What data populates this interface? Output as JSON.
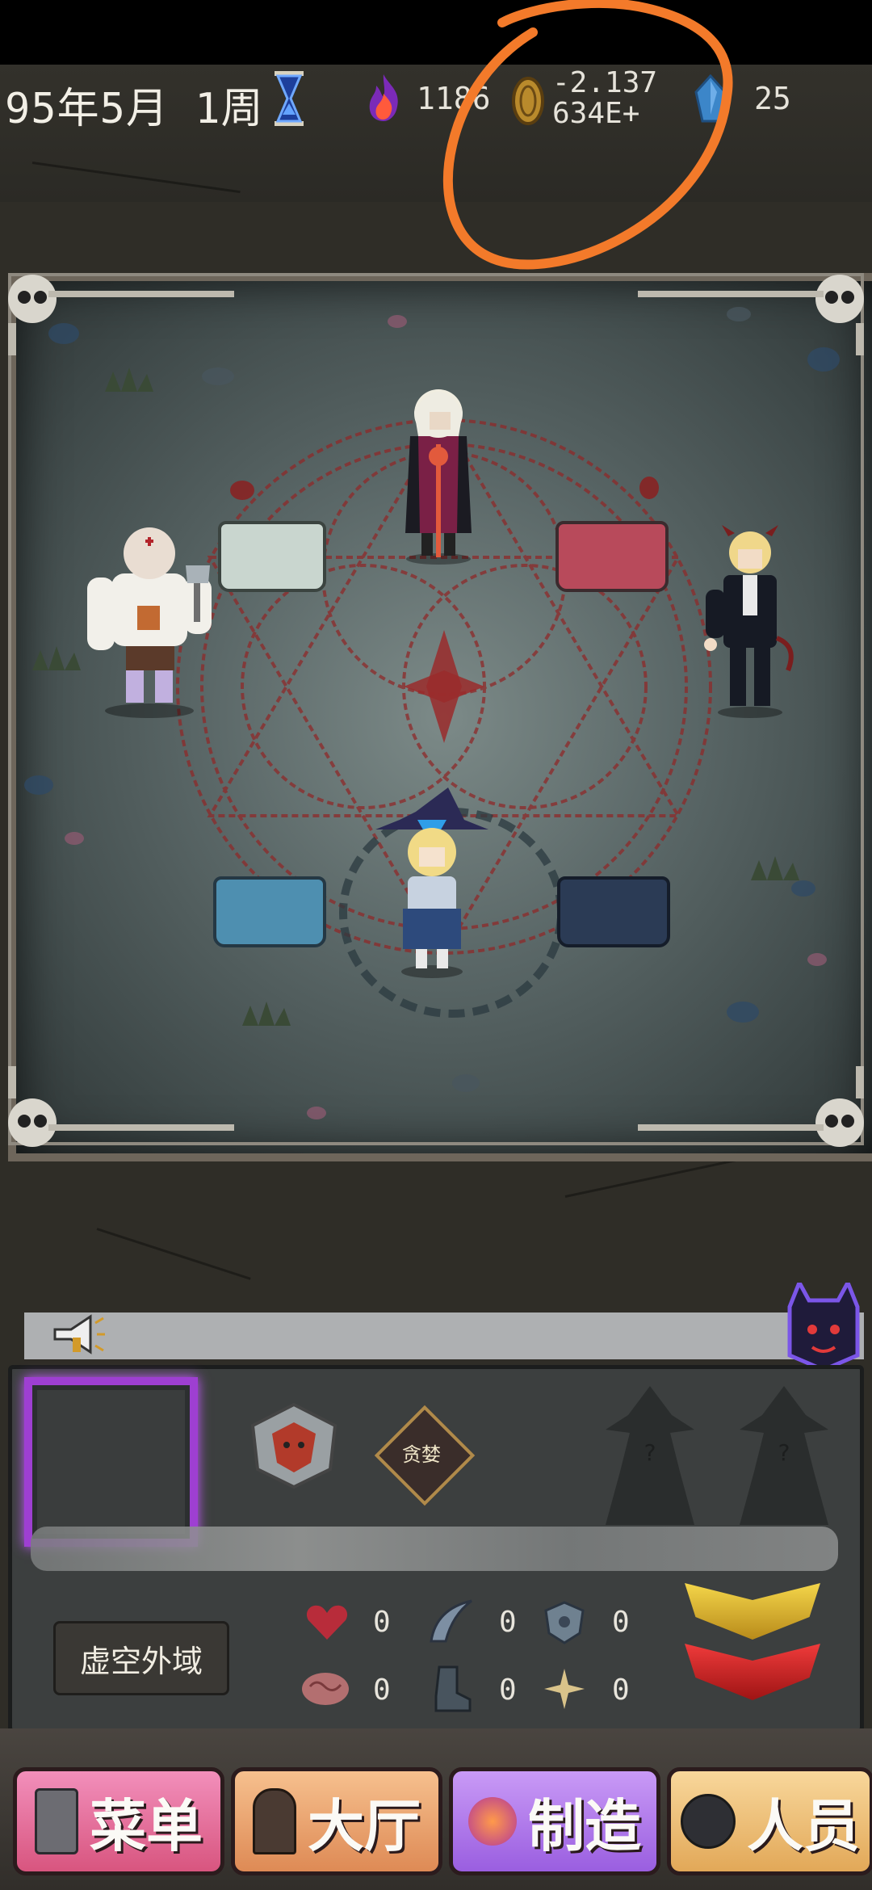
{
  "hud": {
    "date": "95年5月 1周",
    "flame_value": "1186",
    "coin_value_line1": "-2.137",
    "coin_value_line2": "634E+",
    "gem_value": "25"
  },
  "icons": {
    "hourglass": "hourglass-icon",
    "flame": "flame-icon",
    "coin": "coin-icon",
    "gem": "gem-icon",
    "megaphone": "megaphone-icon",
    "demon": "demon-icon"
  },
  "panel": {
    "region_label": "虚空外域",
    "badge_text": "贪婪",
    "stats": [
      {
        "icon": "heart-icon",
        "value": "0"
      },
      {
        "icon": "claw-icon",
        "value": "0"
      },
      {
        "icon": "shield-icon",
        "value": "0"
      },
      {
        "icon": "brain-icon",
        "value": "0"
      },
      {
        "icon": "boot-icon",
        "value": "0"
      },
      {
        "icon": "sparkle-icon",
        "value": "0"
      }
    ]
  },
  "nav": [
    {
      "label": "菜单",
      "color": "#e86aa3"
    },
    {
      "label": "大厅",
      "color": "#f0a76d"
    },
    {
      "label": "制造",
      "color": "#b47bf0"
    },
    {
      "label": "人员",
      "color": "#f0c37a"
    }
  ],
  "colors": {
    "annotation": "#f37a2a",
    "portal": "#9e3fd2"
  }
}
